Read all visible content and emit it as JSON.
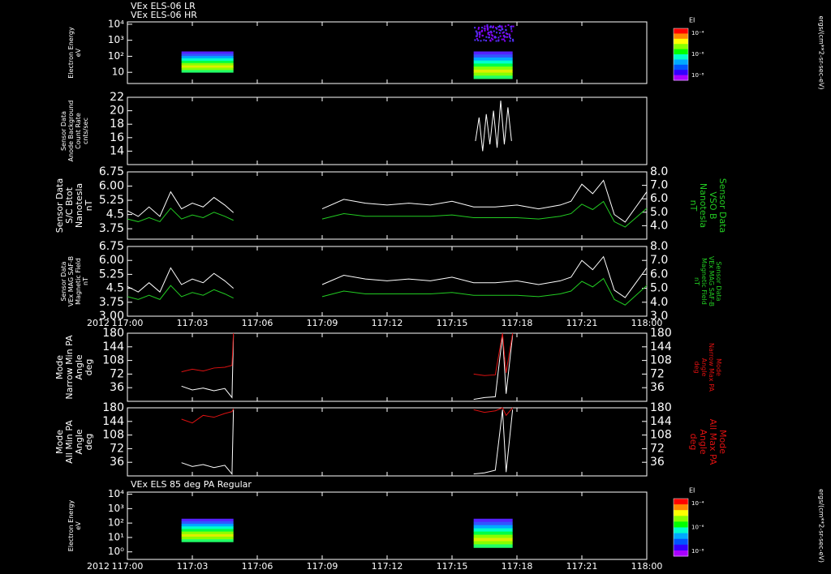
{
  "colors": {
    "background": "#000000",
    "white": "#ffffff",
    "green": "#22cc22",
    "red": "#dd1111",
    "colorbar": [
      "#ff0000",
      "#ff8800",
      "#ffff00",
      "#88ff00",
      "#00ff00",
      "#00ffcc",
      "#00aaff",
      "#0055ff",
      "#3300ff",
      "#aa00ff"
    ]
  },
  "chart_data": [
    {
      "id": "p1",
      "type": "heatmap",
      "titles": [
        "VEx ELS-06 LR",
        "VEx ELS-06 HR"
      ],
      "ylabel_lines": [
        "Electron Energy",
        "eV"
      ],
      "ytick_labels": [
        "10⁴",
        "10³",
        "10²",
        "10"
      ],
      "ytick_values": [
        10000,
        1000,
        100,
        10
      ],
      "ylim": [
        2,
        14000
      ],
      "y_scale": "log",
      "colorbar": {
        "label": "EI",
        "tick_labels": [
          "10⁻⁴",
          "10⁻⁶",
          "10⁻⁸"
        ]
      },
      "colorbar_units": "ergs/(cm**2-sr-sec-eV)",
      "blocks": [
        {
          "x_start": "117:02:30",
          "x_end": "117:04:54",
          "e_min": 10,
          "e_max": 200
        },
        {
          "x_start": "117:16:00",
          "x_end": "117:17:48",
          "e_min": 4,
          "e_max": 200
        },
        {
          "x_start": "117:16:00",
          "x_end": "117:17:48",
          "e_min": 1000,
          "e_max": 10000,
          "sparse": true
        }
      ]
    },
    {
      "id": "p2",
      "type": "line",
      "ylabel_lines": [
        "Sensor Data",
        "Anode Background",
        "Count Rate",
        "cnts/sec"
      ],
      "ytick_values": [
        22,
        20,
        18,
        16,
        14
      ],
      "ylim": [
        12,
        22
      ],
      "series": [
        {
          "color": "white",
          "x": [
            "117:16:05",
            "117:16:15",
            "117:16:25",
            "117:16:35",
            "117:16:45",
            "117:16:55",
            "117:17:05",
            "117:17:15",
            "117:17:25",
            "117:17:35",
            "117:17:45"
          ],
          "values": [
            15.5,
            19.0,
            14.0,
            19.5,
            15.0,
            20.0,
            14.5,
            21.5,
            15.0,
            20.5,
            15.5
          ]
        }
      ]
    },
    {
      "id": "p3",
      "type": "line",
      "ylabel_lines": [
        "Sensor Data",
        "S/C Btot",
        "Nanotesla",
        "nT"
      ],
      "ytick_values": [
        6.75,
        6.0,
        5.25,
        4.5,
        3.75
      ],
      "ylim": [
        3.2,
        6.75
      ],
      "y2label_lines": [
        "Sensor Data",
        "VSO B",
        "Nanotesla",
        "nT"
      ],
      "y2tick_values": [
        8.0,
        7.0,
        6.0,
        5.0,
        4.0
      ],
      "y2lim": [
        3.0,
        8.0
      ],
      "series": [
        {
          "axis": "left",
          "color": "white",
          "x": [
            "117:00:00",
            "117:00:30",
            "117:01:00",
            "117:01:30",
            "117:02:00",
            "117:02:30",
            "117:03:00",
            "117:03:30",
            "117:04:00",
            "117:04:30",
            "117:04:54",
            "117:09:00",
            "117:10:00",
            "117:11:00",
            "117:12:00",
            "117:13:00",
            "117:14:00",
            "117:15:00",
            "117:16:00",
            "117:17:00",
            "117:18:00",
            "117:19:00",
            "117:20:00",
            "117:20:30",
            "117:21:00",
            "117:21:30",
            "117:22:00",
            "117:22:30",
            "117:23:00",
            "117:23:30",
            "117:24:00"
          ],
          "values": [
            4.7,
            4.4,
            4.9,
            4.4,
            5.7,
            4.8,
            5.1,
            4.9,
            5.4,
            5.0,
            4.6,
            4.8,
            5.3,
            5.1,
            5.0,
            5.1,
            5.0,
            5.2,
            4.9,
            4.9,
            5.0,
            4.8,
            5.0,
            5.2,
            6.1,
            5.6,
            6.3,
            4.5,
            4.1,
            4.9,
            5.7
          ]
        },
        {
          "axis": "right",
          "color": "green",
          "x": [
            "117:00:00",
            "117:00:30",
            "117:01:00",
            "117:01:30",
            "117:02:00",
            "117:02:30",
            "117:03:00",
            "117:03:30",
            "117:04:00",
            "117:04:30",
            "117:04:54",
            "117:09:00",
            "117:10:00",
            "117:11:00",
            "117:12:00",
            "117:13:00",
            "117:14:00",
            "117:15:00",
            "117:16:00",
            "117:17:00",
            "117:18:00",
            "117:19:00",
            "117:20:00",
            "117:20:30",
            "117:21:00",
            "117:21:30",
            "117:22:00",
            "117:22:30",
            "117:23:00",
            "117:23:30",
            "117:24:00"
          ],
          "values": [
            4.5,
            4.3,
            4.6,
            4.3,
            5.3,
            4.5,
            4.8,
            4.6,
            5.0,
            4.7,
            4.4,
            4.5,
            4.9,
            4.7,
            4.7,
            4.7,
            4.7,
            4.8,
            4.6,
            4.6,
            4.6,
            4.5,
            4.7,
            4.9,
            5.6,
            5.2,
            5.8,
            4.3,
            3.9,
            4.6,
            5.3
          ]
        }
      ]
    },
    {
      "id": "p4",
      "type": "line",
      "ylabel_lines": [
        "Sensor Data",
        "VEx MAG SAF-B",
        "Magnetic Field",
        "nT"
      ],
      "ytick_values": [
        6.75,
        6.0,
        5.25,
        4.5,
        3.75,
        3.0
      ],
      "ylim": [
        3.0,
        6.75
      ],
      "y2label_lines": [
        "Sensor Data",
        "VEx MAG SAF-B",
        "Magnetic Field",
        "nT"
      ],
      "y2tick_values": [
        8.0,
        7.0,
        6.0,
        5.0,
        4.0,
        3.0
      ],
      "y2lim": [
        3.0,
        8.0
      ],
      "series": [
        {
          "axis": "left",
          "color": "white",
          "x": [
            "117:00:00",
            "117:00:30",
            "117:01:00",
            "117:01:30",
            "117:02:00",
            "117:02:30",
            "117:03:00",
            "117:03:30",
            "117:04:00",
            "117:04:30",
            "117:04:54",
            "117:09:00",
            "117:10:00",
            "117:11:00",
            "117:12:00",
            "117:13:00",
            "117:14:00",
            "117:15:00",
            "117:16:00",
            "117:17:00",
            "117:18:00",
            "117:19:00",
            "117:20:00",
            "117:20:30",
            "117:21:00",
            "117:21:30",
            "117:22:00",
            "117:22:30",
            "117:23:00",
            "117:23:30",
            "117:24:00"
          ],
          "values": [
            4.6,
            4.3,
            4.8,
            4.3,
            5.6,
            4.7,
            5.0,
            4.8,
            5.3,
            4.9,
            4.5,
            4.7,
            5.2,
            5.0,
            4.9,
            5.0,
            4.9,
            5.1,
            4.8,
            4.8,
            4.9,
            4.7,
            4.9,
            5.1,
            6.0,
            5.5,
            6.2,
            4.4,
            4.0,
            4.8,
            5.6
          ]
        },
        {
          "axis": "right",
          "color": "green",
          "x": [
            "117:00:00",
            "117:00:30",
            "117:01:00",
            "117:01:30",
            "117:02:00",
            "117:02:30",
            "117:03:00",
            "117:03:30",
            "117:04:00",
            "117:04:30",
            "117:04:54",
            "117:09:00",
            "117:10:00",
            "117:11:00",
            "117:12:00",
            "117:13:00",
            "117:14:00",
            "117:15:00",
            "117:16:00",
            "117:17:00",
            "117:18:00",
            "117:19:00",
            "117:20:00",
            "117:20:30",
            "117:21:00",
            "117:21:30",
            "117:22:00",
            "117:22:30",
            "117:23:00",
            "117:23:30",
            "117:24:00"
          ],
          "values": [
            4.4,
            4.2,
            4.5,
            4.2,
            5.2,
            4.4,
            4.7,
            4.5,
            4.9,
            4.6,
            4.3,
            4.4,
            4.8,
            4.6,
            4.6,
            4.6,
            4.6,
            4.7,
            4.5,
            4.5,
            4.5,
            4.4,
            4.6,
            4.8,
            5.5,
            5.1,
            5.7,
            4.2,
            3.8,
            4.5,
            5.2
          ]
        }
      ],
      "xtick_labels": [
        "117:00",
        "117:03",
        "117:06",
        "117:09",
        "117:12",
        "117:15",
        "117:18",
        "117:21",
        "118:00"
      ],
      "year_label": "2012"
    },
    {
      "id": "p5",
      "type": "line",
      "ylabel_lines": [
        "Mode",
        "Narrow Min PA",
        "Angle",
        "deg"
      ],
      "ytick_values": [
        180,
        144,
        108,
        72,
        36
      ],
      "ylim": [
        0,
        180
      ],
      "y2label_lines": [
        "Mode",
        "Narrow Max PA",
        "Angle",
        "deg"
      ],
      "y2tick_values": [
        180,
        144,
        108,
        72,
        36
      ],
      "y2lim": [
        0,
        180
      ],
      "series": [
        {
          "axis": "left",
          "color": "white",
          "x": [
            "117:02:30",
            "117:03:00",
            "117:03:30",
            "117:04:00",
            "117:04:30",
            "117:04:50",
            "117:04:54",
            "117:16:00",
            "117:16:30",
            "117:17:00",
            "117:17:20",
            "117:17:30",
            "117:17:48"
          ],
          "values": [
            40,
            30,
            35,
            28,
            34,
            10,
            175,
            5,
            10,
            12,
            175,
            20,
            175
          ]
        },
        {
          "axis": "right",
          "color": "red",
          "x": [
            "117:02:30",
            "117:03:00",
            "117:03:30",
            "117:04:00",
            "117:04:30",
            "117:04:50",
            "117:04:54",
            "117:16:00",
            "117:16:30",
            "117:17:00",
            "117:17:20",
            "117:17:30",
            "117:17:48"
          ],
          "values": [
            78,
            85,
            80,
            88,
            90,
            95,
            180,
            72,
            68,
            70,
            180,
            75,
            180
          ]
        }
      ]
    },
    {
      "id": "p6",
      "type": "line",
      "ylabel_lines": [
        "Mode",
        "All Min PA",
        "Angle",
        "deg"
      ],
      "ytick_values": [
        180,
        144,
        108,
        72,
        36
      ],
      "ylim": [
        0,
        180
      ],
      "y2label_lines": [
        "Mode",
        "All Max PA",
        "Angle",
        "deg"
      ],
      "y2tick_values": [
        180,
        144,
        108,
        72,
        36
      ],
      "y2lim": [
        0,
        180
      ],
      "series": [
        {
          "axis": "left",
          "color": "white",
          "x": [
            "117:02:30",
            "117:03:00",
            "117:03:30",
            "117:04:00",
            "117:04:30",
            "117:04:50",
            "117:04:54",
            "117:16:00",
            "117:16:30",
            "117:17:00",
            "117:17:20",
            "117:17:30",
            "117:17:48"
          ],
          "values": [
            35,
            25,
            30,
            22,
            28,
            5,
            175,
            5,
            8,
            15,
            175,
            10,
            175
          ]
        },
        {
          "axis": "right",
          "color": "red",
          "x": [
            "117:02:30",
            "117:03:00",
            "117:03:30",
            "117:04:00",
            "117:04:30",
            "117:04:50",
            "117:04:54",
            "117:16:00",
            "117:16:30",
            "117:17:00",
            "117:17:20",
            "117:17:30",
            "117:17:48"
          ],
          "values": [
            150,
            140,
            160,
            155,
            165,
            170,
            178,
            175,
            168,
            172,
            180,
            160,
            180
          ]
        }
      ]
    },
    {
      "id": "p7",
      "type": "heatmap",
      "titles": [
        "VEx ELS 85 deg PA Regular"
      ],
      "ylabel_lines": [
        "Electron Energy",
        "eV"
      ],
      "ytick_labels": [
        "10⁴",
        "10³",
        "10²",
        "10¹",
        "10⁰"
      ],
      "ytick_values": [
        10000,
        1000,
        100,
        10,
        1
      ],
      "ylim": [
        0.3,
        14000
      ],
      "y_scale": "log",
      "colorbar": {
        "label": "EI",
        "tick_labels": [
          "10⁻⁴",
          "10⁻⁶",
          "10⁻⁸"
        ]
      },
      "colorbar_units": "ergs/(cm**2-sr-sec-eV)",
      "blocks": [
        {
          "x_start": "117:02:30",
          "x_end": "117:04:54",
          "e_min": 5,
          "e_max": 200
        },
        {
          "x_start": "117:16:00",
          "x_end": "117:17:48",
          "e_min": 2,
          "e_max": 200
        }
      ],
      "xtick_labels": [
        "117:00",
        "117:03",
        "117:06",
        "117:09",
        "117:12",
        "117:15",
        "117:18",
        "117:21",
        "118:00"
      ],
      "year_label": "2012"
    }
  ]
}
